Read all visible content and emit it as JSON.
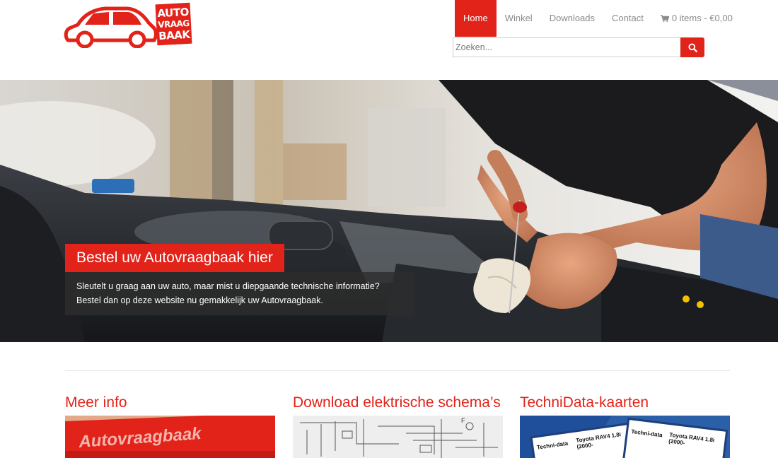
{
  "logo": {
    "badge_line1": "AUTO",
    "badge_line2": "VRAAG",
    "badge_line3": "BAAK",
    "icon": "car-icon",
    "brand_color": "#e2231a"
  },
  "nav": {
    "items": [
      {
        "label": "Home",
        "active": true
      },
      {
        "label": "Winkel",
        "active": false
      },
      {
        "label": "Downloads",
        "active": false
      },
      {
        "label": "Contact",
        "active": false
      }
    ],
    "cart": {
      "label": "0 items - €0,00",
      "icon": "cart-icon"
    }
  },
  "search": {
    "placeholder": "Zoeken...",
    "icon": "search-icon"
  },
  "hero": {
    "title": "Bestel uw Autovraagbaak hier",
    "text": "Sleutelt u graag aan uw auto, maar mist u diepgaande technische informatie? Bestel dan op deze website nu gemakkelijk uw Autovraagbaak."
  },
  "columns": [
    {
      "title": "Meer info",
      "image_label": "Autovraagbaak"
    },
    {
      "title": "Download elektrische schema’s"
    },
    {
      "title": "TechniData-kaarten",
      "card_text": [
        "Techni-data",
        "Toyota RAV4 1.8i",
        "(2000-"
      ]
    }
  ],
  "colors": {
    "accent": "#e2231a",
    "nav_text": "#8a8a8a"
  }
}
